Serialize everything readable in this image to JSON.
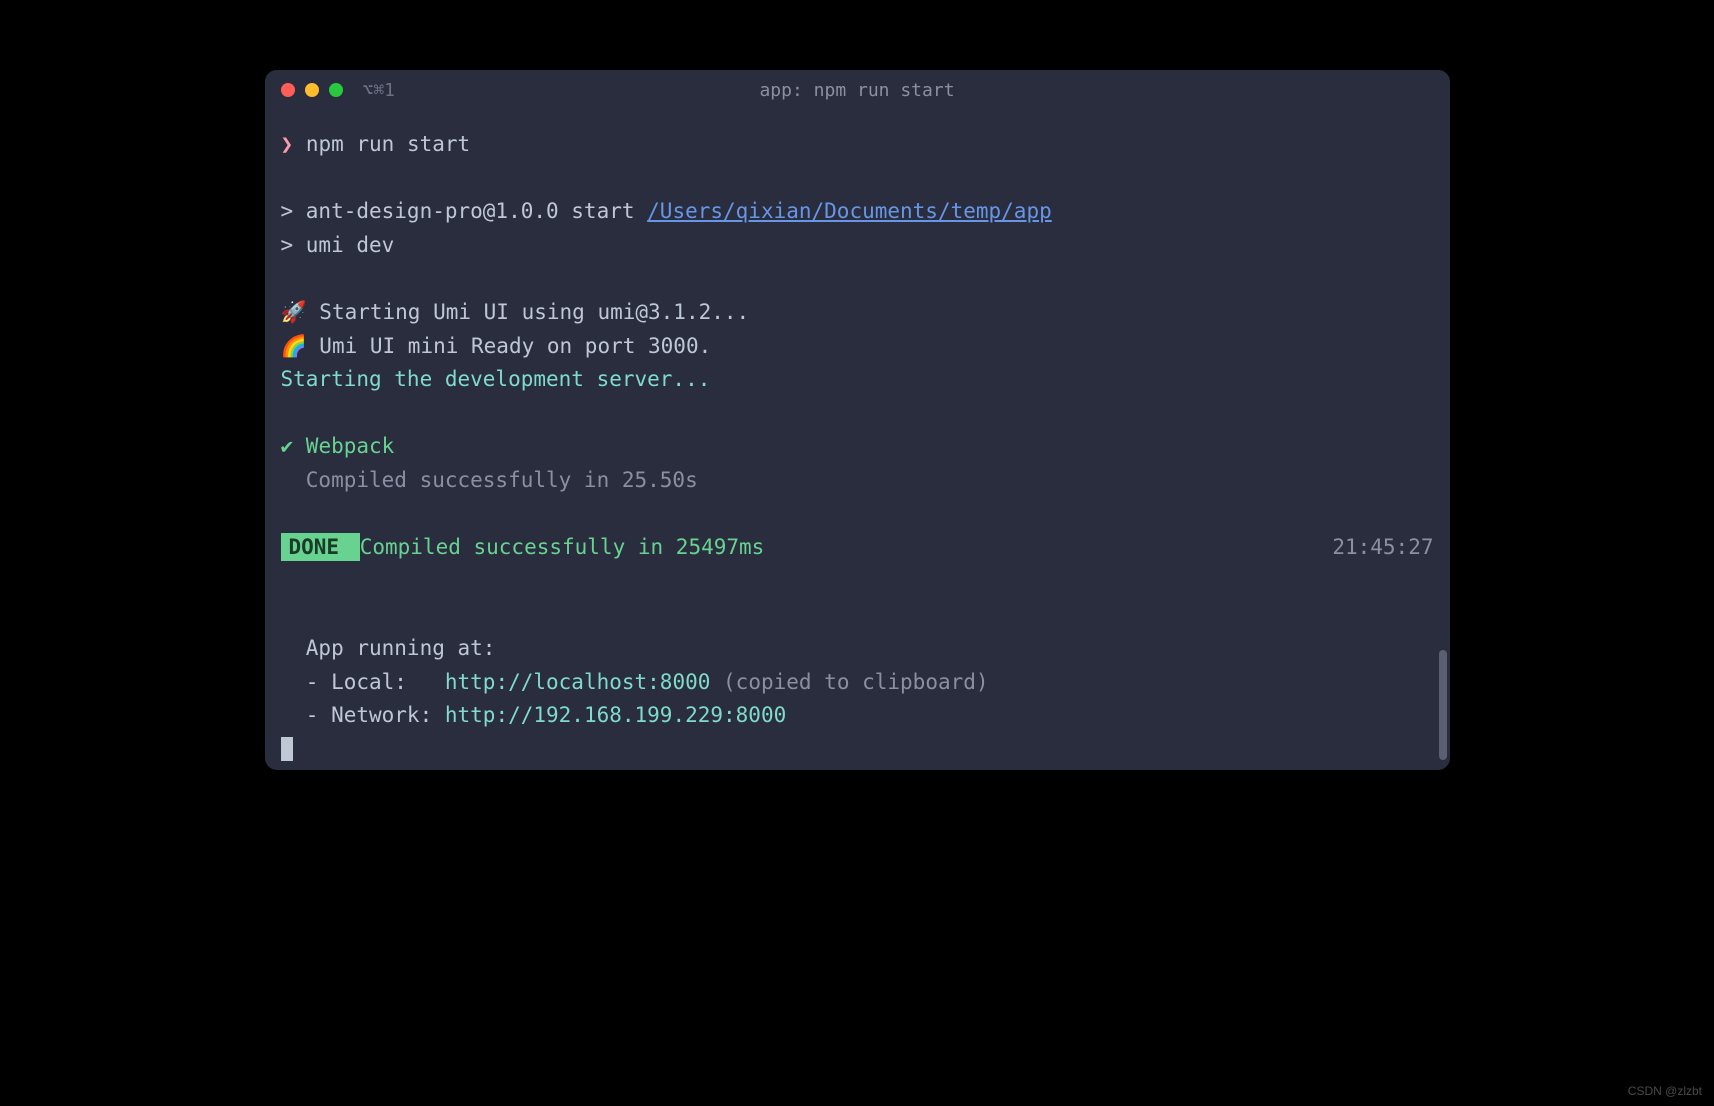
{
  "window": {
    "tab_indicator": "⌥⌘1",
    "title": "app: npm run start"
  },
  "terminal": {
    "prompt": "❯",
    "command": "npm run start",
    "output": {
      "script_line": "> ant-design-pro@1.0.0 start ",
      "script_path": "/Users/qixian/Documents/temp/app",
      "umi_dev": "> umi dev",
      "rocket": "🚀",
      "starting_umi": " Starting Umi UI using umi@3.1.2...",
      "rainbow": "🌈",
      "umi_ready": " Umi UI mini Ready on port 3000.",
      "dev_server": "Starting the development server...",
      "check": "✔",
      "webpack_label": " Webpack",
      "compiled_time": "  Compiled successfully in 25.50s",
      "done_badge": " DONE ",
      "done_message": "  Compiled successfully in 25497ms",
      "timestamp": "21:45:27",
      "app_running": "  App running at:",
      "local_label": "  - Local:   ",
      "local_url": "http://localhost:8000",
      "clipboard_note": " (copied to clipboard)",
      "network_label": "  - Network: ",
      "network_url": "http://192.168.199.229:8000"
    }
  },
  "watermark": "CSDN @zlzbt"
}
